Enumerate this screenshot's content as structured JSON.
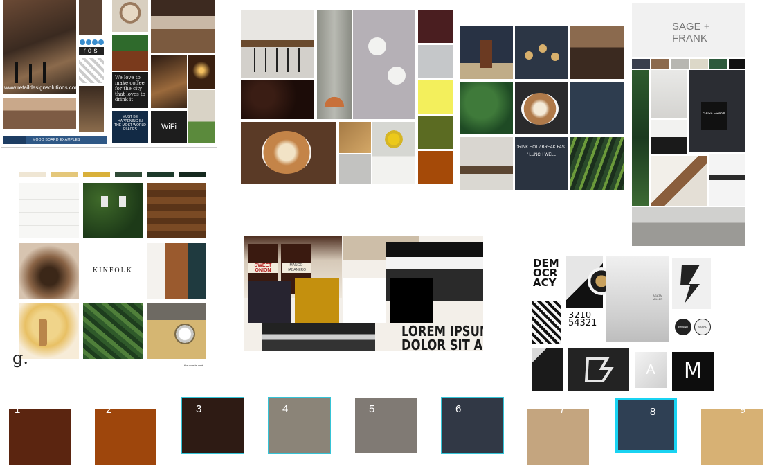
{
  "boards": {
    "b1": {
      "url": "www.retaildesignsolutions.com",
      "footer": "MOOD BOARD EXAMPLES",
      "brand_letters": "rds",
      "chalk_text": "We love to make coffee for the city that loves to drink it",
      "sign_text": "MUST BE HAPPENING IN THE MOST WORLD PLACES",
      "wifi_label": "WiFi"
    },
    "b2": {
      "swatches": [
        "#4a1e20",
        "#c5c7c9",
        "#f3ef5c",
        "#5b6b22",
        "#a54a08"
      ]
    },
    "b3": {
      "sign_text": "DRINK HOT / BREAK FAST / LUNCH WELL"
    },
    "b4": {
      "brand": "SAGE + FRANK",
      "swatches": [
        "#3a3f4d",
        "#8c6a4e",
        "#b7b6b1",
        "#dcd8c8",
        "#2e5a3c",
        "#111111"
      ],
      "mug_text": "SAGE FRANK"
    },
    "b5": {
      "swatches": [
        "#efe6d4",
        "#e4c77a",
        "#d9b03a",
        "#2f4a36",
        "#1d3a2b",
        "#15291f"
      ],
      "brand": "KINFOLK",
      "logo": "g.",
      "caption": "the coterie café"
    },
    "b6": {
      "jar1": "SWEET ONION",
      "jar2": "MANGO HABANERO",
      "headline_1": "LOREM IPSUM",
      "headline_2": "DOLOR SIT AM",
      "swatches": [
        "#272430",
        "#c4900e",
        "#ffffff",
        "#000000"
      ]
    },
    "b7": {
      "democracy": [
        "DEM",
        "OCR",
        "ACY"
      ],
      "numbers": "3210 54321",
      "name": "AGATA MILLER",
      "brand_letter": "M",
      "letter_a": "A",
      "badge": "BRAND"
    }
  },
  "palette": [
    {
      "num": "1",
      "color": "#5b2510",
      "raised": false,
      "style": "plain"
    },
    {
      "num": "2",
      "color": "#9e460c",
      "raised": false,
      "style": "plain"
    },
    {
      "num": "3",
      "color": "#2e1b14",
      "raised": true,
      "style": "lite"
    },
    {
      "num": "4",
      "color": "#8b8478",
      "raised": true,
      "style": "lite"
    },
    {
      "num": "5",
      "color": "#807a74",
      "raised": true,
      "style": "plain"
    },
    {
      "num": "6",
      "color": "#313845",
      "raised": true,
      "style": "lite"
    },
    {
      "num": "7",
      "color": "#c4a57f",
      "raised": false,
      "style": "plain"
    },
    {
      "num": "8",
      "color": "#2f4054",
      "raised": true,
      "style": "selected"
    },
    {
      "num": "9",
      "color": "#d7b174",
      "raised": false,
      "style": "plain"
    }
  ]
}
